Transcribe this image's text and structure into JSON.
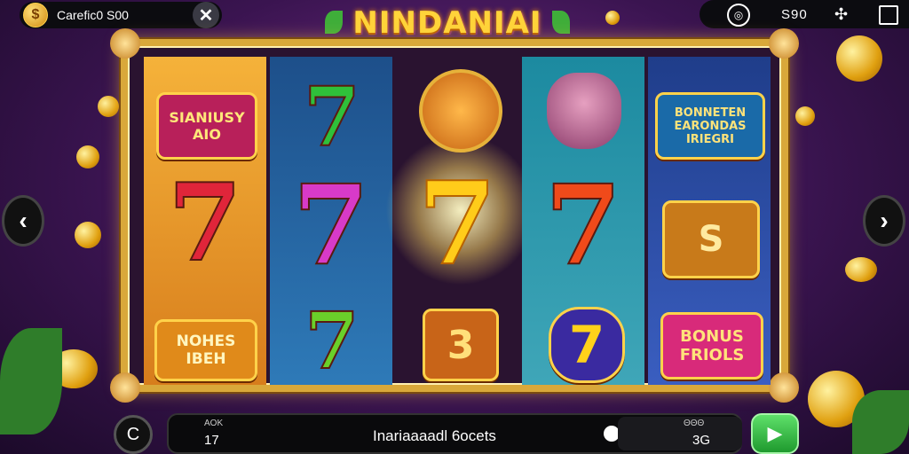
{
  "header": {
    "balance_icon": "$",
    "balance_text": "Carefic0 S00",
    "close_label": "✕",
    "score_text": "S90",
    "target_icon": "target-icon",
    "grid_icon": "grid-icon",
    "window_icon": "square-icon"
  },
  "logo": {
    "text": "NINDANIAI"
  },
  "reels": {
    "r1": [
      "SIANIUSY\nAIO",
      "7",
      "NOHES\nIBEH"
    ],
    "r2": [
      "7",
      "7",
      "7"
    ],
    "r3": [
      "",
      "7",
      "3"
    ],
    "r4": [
      "",
      "7",
      "7"
    ],
    "r5": [
      "BONNETEN\nEARONDAS\nIRIEGRI",
      "S",
      "BONUS\nFRIOLS"
    ]
  },
  "nav": {
    "left": "‹",
    "right": "›"
  },
  "bottom": {
    "spin_small_icon": "C",
    "bet_caption": "AOK",
    "bet_value": "17",
    "message": "Inariaaaadl 6ocets",
    "win_caption": "ΘΘΘ",
    "win_value": "3G",
    "play_icon": "▶"
  },
  "colors": {
    "frame_gold": "#d9a83a",
    "logo_yellow": "#ffd43a",
    "play_green": "#1f9a2e",
    "bg_purple": "#3a1450"
  }
}
